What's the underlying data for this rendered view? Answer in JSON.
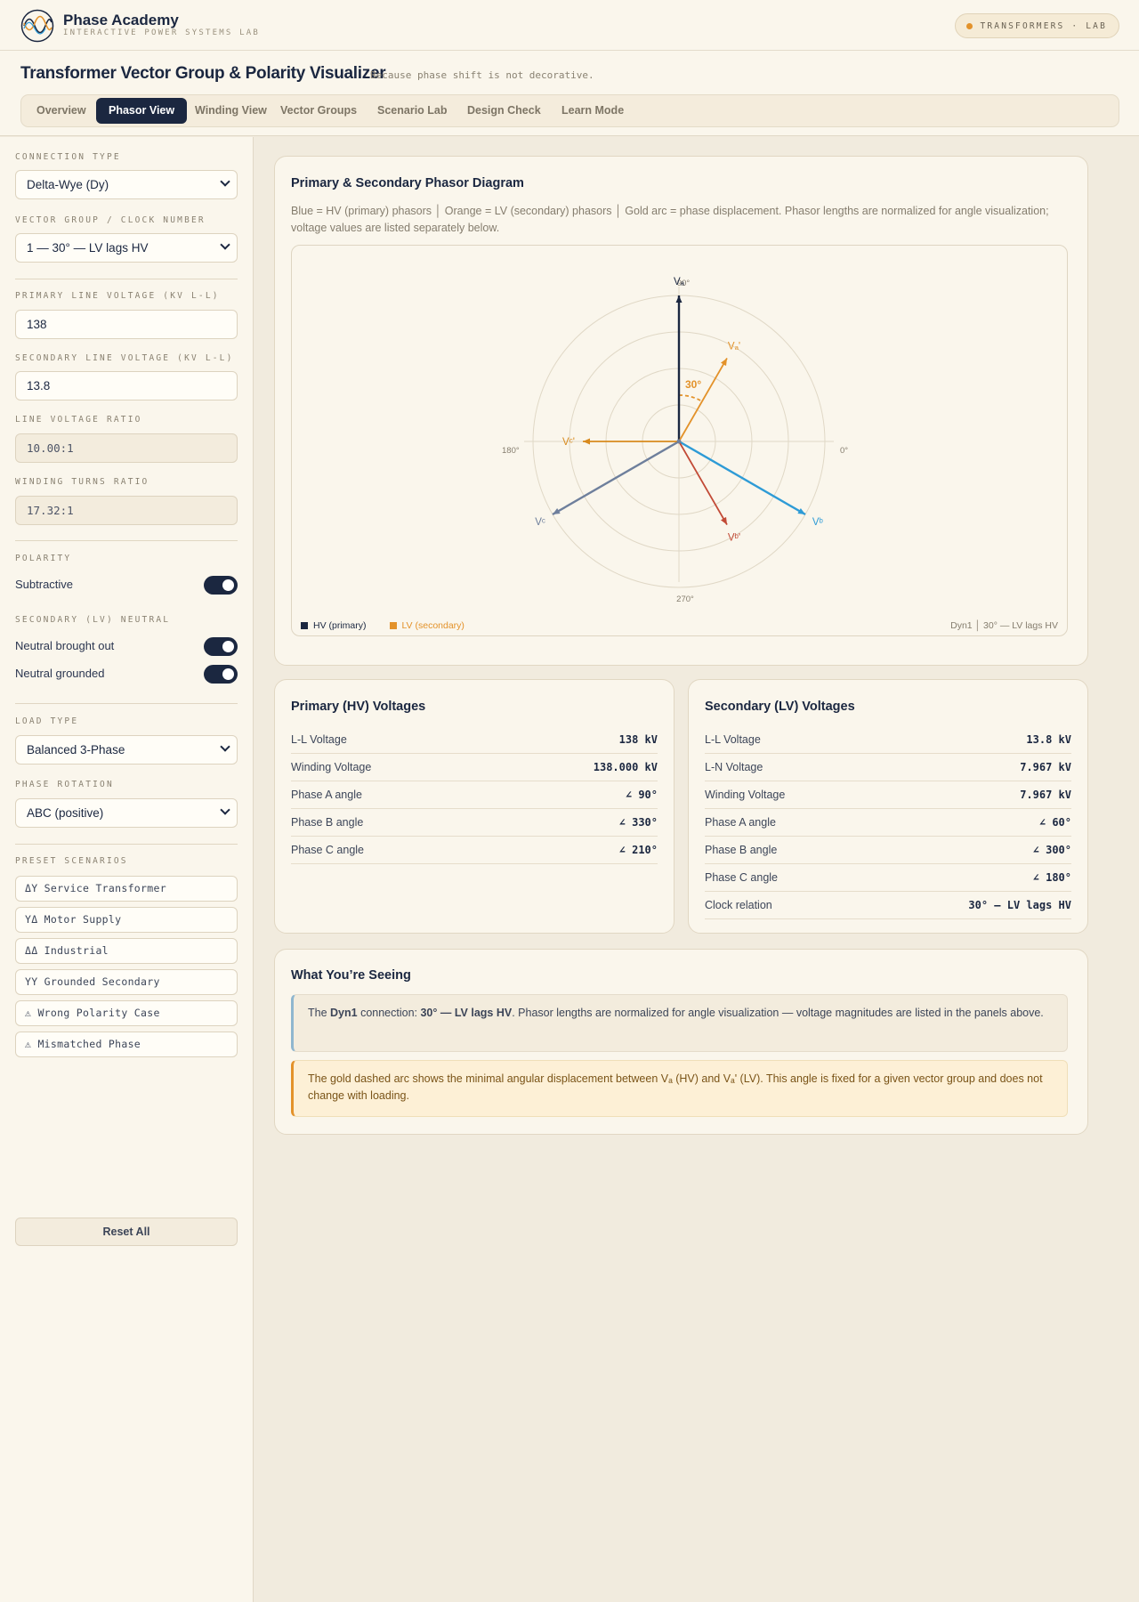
{
  "app": {
    "brand": "Phase Academy",
    "brand_sub": "INTERACTIVE POWER SYSTEMS LAB",
    "badge": "TRANSFORMERS · LAB"
  },
  "page": {
    "title": "Transformer Vector Group & Polarity Visualizer",
    "subtitle": "Because phase shift is not decorative."
  },
  "tabs": [
    {
      "label": "Overview"
    },
    {
      "label": "Phasor View",
      "active": true
    },
    {
      "label": "Winding View"
    },
    {
      "label": "Vector Groups"
    },
    {
      "label": "Scenario Lab"
    },
    {
      "label": "Design Check"
    },
    {
      "label": "Learn Mode"
    }
  ],
  "sidebar": {
    "connection_type": {
      "label": "CONNECTION TYPE",
      "value": "Delta-Wye (Dy)"
    },
    "vector_group": {
      "label": "VECTOR GROUP / CLOCK NUMBER",
      "value": "1 — 30° — LV lags HV"
    },
    "primary_voltage": {
      "label": "PRIMARY LINE VOLTAGE (KV L-L)",
      "value": "138"
    },
    "secondary_voltage": {
      "label": "SECONDARY LINE VOLTAGE (KV L-L)",
      "value": "13.8"
    },
    "line_ratio": {
      "label": "LINE VOLTAGE RATIO",
      "value": "10.00:1"
    },
    "turns_ratio": {
      "label": "WINDING TURNS RATIO",
      "value": "17.32:1"
    },
    "polarity": {
      "label": "POLARITY",
      "toggle_label": "Subtractive",
      "on": true
    },
    "neutral": {
      "label": "SECONDARY (LV) NEUTRAL",
      "brought_out": {
        "label": "Neutral brought out",
        "on": true
      },
      "grounded": {
        "label": "Neutral grounded",
        "on": true
      }
    },
    "load_type": {
      "label": "LOAD TYPE",
      "value": "Balanced 3-Phase"
    },
    "phase_rotation": {
      "label": "PHASE ROTATION",
      "value": "ABC (positive)"
    },
    "presets": {
      "label": "PRESET SCENARIOS",
      "items": [
        "ΔY Service Transformer",
        "YΔ Motor Supply",
        "ΔΔ Industrial",
        "YY Grounded Secondary",
        "⚠ Wrong Polarity Case",
        "⚠ Mismatched Phase"
      ]
    },
    "reset_label": "Reset All"
  },
  "phasor_card": {
    "title": "Primary & Secondary Phasor Diagram",
    "description": "Blue = HV (primary) phasors │ Orange = LV (secondary) phasors │ Gold arc = phase displacement. Phasor lengths are normalized for angle visualization; voltage values are listed separately below.",
    "legend_hv": "HV (primary)",
    "legend_lv": "LV (secondary)",
    "footer": "Dyn1 │ 30° — LV lags HV",
    "axis_labels": {
      "deg90": "90°",
      "deg0": "0°",
      "deg180": "180°",
      "deg270": "270°"
    },
    "displacement_label": "30°",
    "phasors": [
      {
        "name": "Vₐ",
        "angle_deg": 90,
        "group": "hv",
        "color": "#1b2740"
      },
      {
        "name": "Vᵇ",
        "angle_deg": 330,
        "group": "hv",
        "color": "#2e9bd6"
      },
      {
        "name": "Vᶜ",
        "angle_deg": 210,
        "group": "hv",
        "color": "#6e7f9c"
      },
      {
        "name": "Vₐ'",
        "angle_deg": 60,
        "group": "lv",
        "color": "#e3922a"
      },
      {
        "name": "Vᵇ'",
        "angle_deg": 300,
        "group": "lv",
        "color": "#c24a36"
      },
      {
        "name": "Vᶜ'",
        "angle_deg": 180,
        "group": "lv",
        "color": "#d88a1e"
      }
    ],
    "colors": {
      "hv": "#1b2740",
      "lv": "#e3922a",
      "arc": "#e3922a"
    }
  },
  "primary": {
    "title": "Primary (HV) Voltages",
    "rows": [
      {
        "label": "L-L Voltage",
        "value": "138 kV"
      },
      {
        "label": "Winding Voltage",
        "value": "138.000 kV"
      },
      {
        "label": "Phase A angle",
        "value": "∠ 90°"
      },
      {
        "label": "Phase B angle",
        "value": "∠ 330°"
      },
      {
        "label": "Phase C angle",
        "value": "∠ 210°"
      }
    ]
  },
  "secondary": {
    "title": "Secondary (LV) Voltages",
    "rows": [
      {
        "label": "L-L Voltage",
        "value": "13.8 kV"
      },
      {
        "label": "L-N Voltage",
        "value": "7.967 kV"
      },
      {
        "label": "Winding Voltage",
        "value": "7.967 kV"
      },
      {
        "label": "Phase A angle",
        "value": "∠ 60°"
      },
      {
        "label": "Phase B angle",
        "value": "∠ 300°"
      },
      {
        "label": "Phase C angle",
        "value": "∠ 180°"
      },
      {
        "label": "Clock relation",
        "value": "30° — LV lags HV"
      }
    ]
  },
  "explain": {
    "title": "What You’re Seeing",
    "note1": {
      "pre": "The ",
      "group": "Dyn1",
      "mid": " connection: ",
      "relation": "30° — LV lags HV",
      "post": ". Phasor lengths are normalized for angle visualization — voltage magnitudes are listed in the panels above."
    },
    "note2": "The gold dashed arc shows the minimal angular displacement between Vₐ (HV) and Vₐ' (LV). This angle is fixed for a given vector group and does not change with loading."
  }
}
